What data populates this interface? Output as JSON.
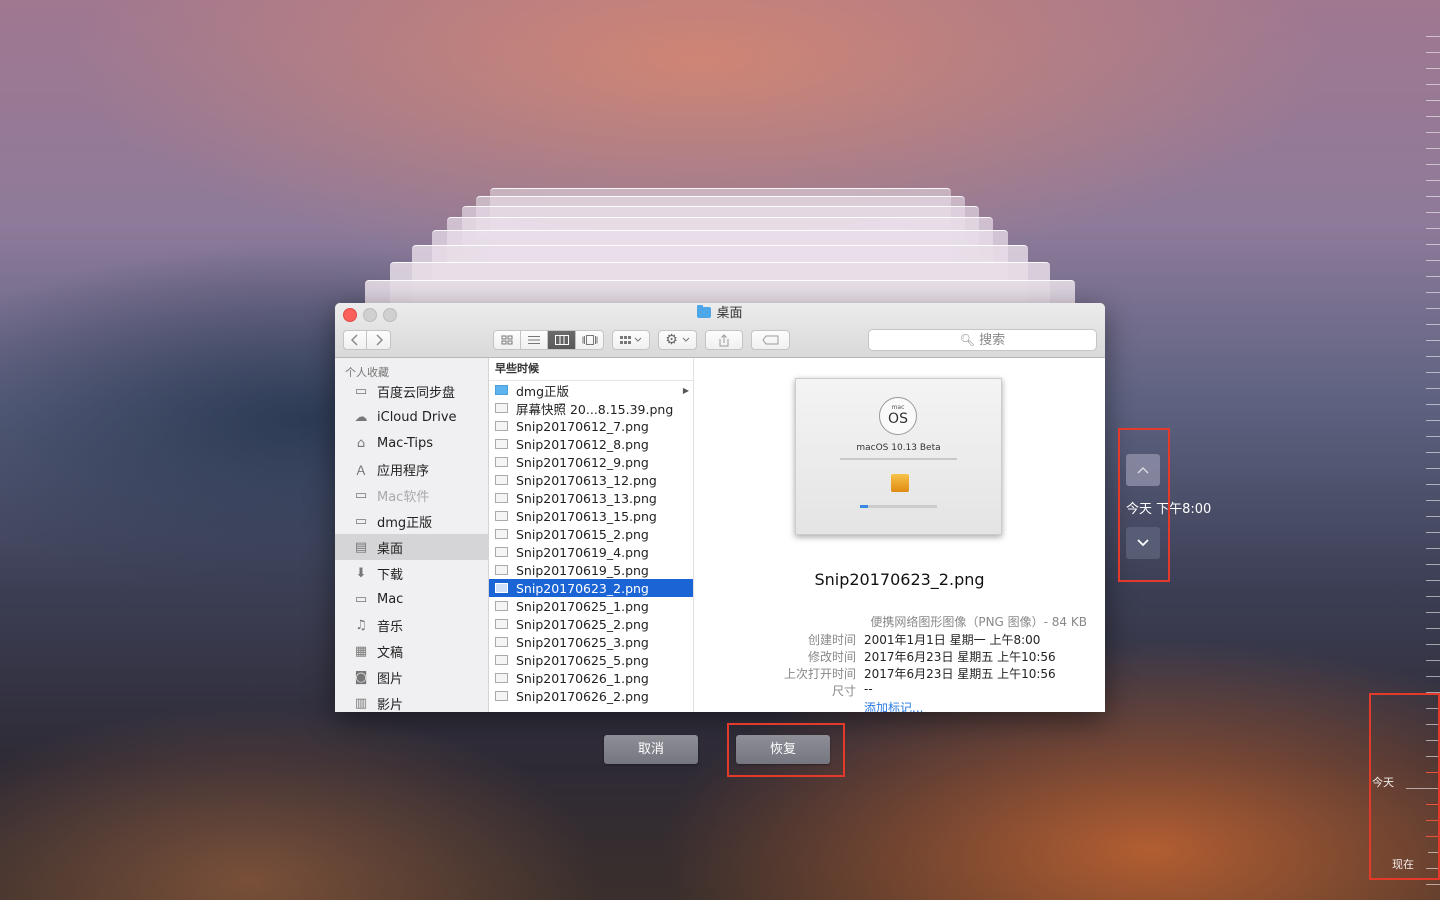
{
  "window": {
    "title": "桌面"
  },
  "toolbar": {
    "back_icon": "chevron-left-icon",
    "forward_icon": "chevron-right-icon",
    "view_icons": [
      "icon-view-icon",
      "list-view-icon",
      "column-view-icon",
      "coverflow-view-icon"
    ],
    "search_placeholder": "搜索"
  },
  "sidebar": {
    "header": "个人收藏",
    "items": [
      {
        "label": "百度云同步盘",
        "icon": "folder-icon",
        "selected": false,
        "dim": false
      },
      {
        "label": "iCloud Drive",
        "icon": "cloud-icon",
        "selected": false,
        "dim": false
      },
      {
        "label": "Mac-Tips",
        "icon": "home-icon",
        "selected": false,
        "dim": false
      },
      {
        "label": "应用程序",
        "icon": "applications-icon",
        "selected": false,
        "dim": false
      },
      {
        "label": "Mac软件",
        "icon": "folder-icon",
        "selected": false,
        "dim": true
      },
      {
        "label": "dmg正版",
        "icon": "folder-icon",
        "selected": false,
        "dim": false
      },
      {
        "label": "桌面",
        "icon": "desktop-icon",
        "selected": true,
        "dim": false
      },
      {
        "label": "下载",
        "icon": "download-icon",
        "selected": false,
        "dim": false
      },
      {
        "label": "Mac",
        "icon": "folder-icon",
        "selected": false,
        "dim": false
      },
      {
        "label": "音乐",
        "icon": "music-icon",
        "selected": false,
        "dim": false
      },
      {
        "label": "文稿",
        "icon": "documents-icon",
        "selected": false,
        "dim": false
      },
      {
        "label": "图片",
        "icon": "camera-icon",
        "selected": false,
        "dim": false
      },
      {
        "label": "影片",
        "icon": "film-icon",
        "selected": false,
        "dim": false
      }
    ]
  },
  "file_list": {
    "header": "早些时候",
    "items": [
      {
        "name": "dmg正版",
        "kind": "folder",
        "selected": false
      },
      {
        "name": "屏幕快照 20...8.15.39.png",
        "kind": "image",
        "selected": false
      },
      {
        "name": "Snip20170612_7.png",
        "kind": "image",
        "selected": false
      },
      {
        "name": "Snip20170612_8.png",
        "kind": "image",
        "selected": false
      },
      {
        "name": "Snip20170612_9.png",
        "kind": "image",
        "selected": false
      },
      {
        "name": "Snip20170613_12.png",
        "kind": "image",
        "selected": false
      },
      {
        "name": "Snip20170613_13.png",
        "kind": "image",
        "selected": false
      },
      {
        "name": "Snip20170613_15.png",
        "kind": "image",
        "selected": false
      },
      {
        "name": "Snip20170615_2.png",
        "kind": "image",
        "selected": false
      },
      {
        "name": "Snip20170619_4.png",
        "kind": "image",
        "selected": false
      },
      {
        "name": "Snip20170619_5.png",
        "kind": "image",
        "selected": false
      },
      {
        "name": "Snip20170623_2.png",
        "kind": "image",
        "selected": true
      },
      {
        "name": "Snip20170625_1.png",
        "kind": "image",
        "selected": false
      },
      {
        "name": "Snip20170625_2.png",
        "kind": "image",
        "selected": false
      },
      {
        "name": "Snip20170625_3.png",
        "kind": "image",
        "selected": false
      },
      {
        "name": "Snip20170625_5.png",
        "kind": "image",
        "selected": false
      },
      {
        "name": "Snip20170626_1.png",
        "kind": "image",
        "selected": false
      },
      {
        "name": "Snip20170626_2.png",
        "kind": "image",
        "selected": false
      }
    ]
  },
  "preview": {
    "thumb_logo_small": "mac",
    "thumb_logo_big": "OS",
    "thumb_title": "macOS 10.13 Beta",
    "filename": "Snip20170623_2.png",
    "kind": "便携网络图形图像（PNG 图像）- 84 KB",
    "meta": [
      {
        "k": "创建时间",
        "v": "2001年1月1日 星期一 上午8:00",
        "link": false
      },
      {
        "k": "修改时间",
        "v": "2017年6月23日 星期五 上午10:56",
        "link": false
      },
      {
        "k": "上次打开时间",
        "v": "2017年6月23日 星期五 上午10:56",
        "link": false
      },
      {
        "k": "尺寸",
        "v": "--",
        "link": false
      },
      {
        "k": "",
        "v": "添加标记...",
        "link": true
      }
    ]
  },
  "buttons": {
    "cancel": "取消",
    "restore": "恢复"
  },
  "time_nav": {
    "up_icon": "chevron-up-icon",
    "down_icon": "chevron-down-icon",
    "current_time": "今天 下午8:00"
  },
  "timeline": {
    "today": "今天",
    "now": "现在"
  },
  "colors": {
    "highlight": "#1b64d6",
    "annotation_red": "#e43a2c",
    "close_red": "#fc605b"
  }
}
